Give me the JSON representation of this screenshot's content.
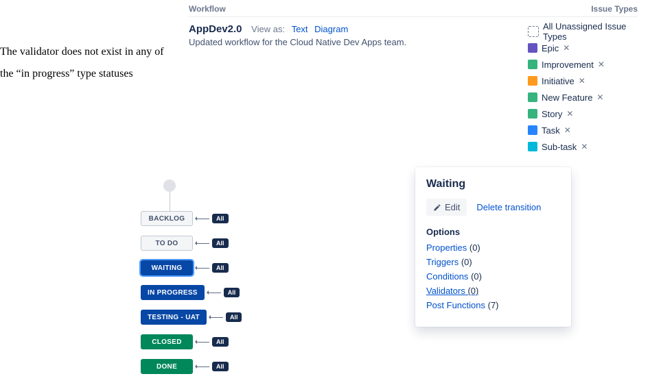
{
  "annotation": "The validator does not exist in any of the “in progress” type statuses",
  "header": {
    "workflow_label": "Workflow",
    "issue_types_label": "Issue Types"
  },
  "workflow": {
    "name": "AppDev2.0",
    "view_as_label": "View as:",
    "view_text": "Text",
    "view_diagram": "Diagram",
    "description": "Updated workflow for the Cloud Native Dev Apps team."
  },
  "issue_types": [
    {
      "label": "All Unassigned Issue Types",
      "color": "unassigned",
      "removable": false
    },
    {
      "label": "Epic",
      "color": "#6554c0",
      "removable": true
    },
    {
      "label": "Improvement",
      "color": "#36b37e",
      "removable": true
    },
    {
      "label": "Initiative",
      "color": "#ff991f",
      "removable": true
    },
    {
      "label": "New Feature",
      "color": "#36b37e",
      "removable": true
    },
    {
      "label": "Story",
      "color": "#36b37e",
      "removable": true
    },
    {
      "label": "Task",
      "color": "#2684ff",
      "removable": true
    },
    {
      "label": "Sub-task",
      "color": "#00b8d9",
      "removable": true
    }
  ],
  "diagram": {
    "all_badge": "All",
    "statuses": [
      {
        "name": "BACKLOG",
        "category": "todo"
      },
      {
        "name": "TO DO",
        "category": "todo"
      },
      {
        "name": "WAITING",
        "category": "inprogress",
        "selected": true
      },
      {
        "name": "IN PROGRESS",
        "category": "inprogress"
      },
      {
        "name": "TESTING - UAT",
        "category": "inprogress"
      },
      {
        "name": "CLOSED",
        "category": "done"
      },
      {
        "name": "DONE",
        "category": "done"
      }
    ]
  },
  "panel": {
    "title": "Waiting",
    "edit_label": "Edit",
    "delete_label": "Delete transition",
    "options_label": "Options",
    "options": [
      {
        "label": "Properties",
        "count": 0
      },
      {
        "label": "Triggers",
        "count": 0
      },
      {
        "label": "Conditions",
        "count": 0
      },
      {
        "label": "Validators",
        "count": 0,
        "highlight": true
      },
      {
        "label": "Post Functions",
        "count": 7
      }
    ]
  }
}
